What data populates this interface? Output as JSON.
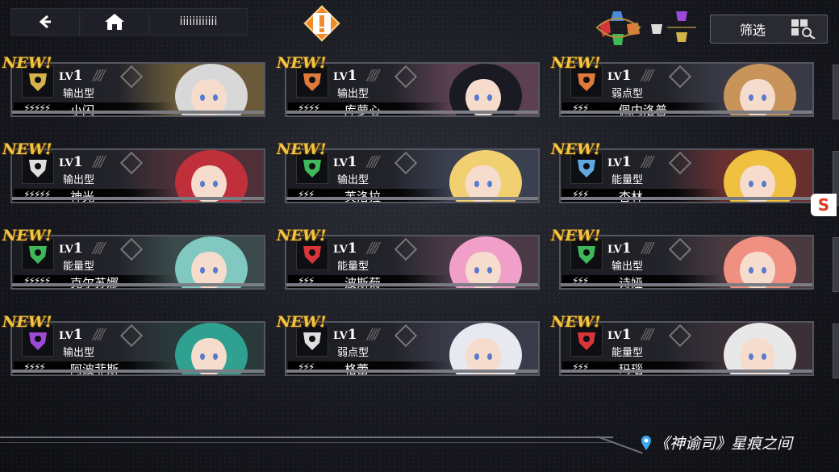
{
  "topbar": {
    "title": "iiiiiiiiiiii"
  },
  "filter": {
    "label": "筛选",
    "icons": [
      "red-wolf-icon",
      "blue-wing-icon",
      "orange-bull-icon",
      "green-tree-icon",
      "purple-crown-icon",
      "gold-star-icon",
      "white-shell-icon"
    ]
  },
  "new_label": "NEW!",
  "lv_prefix": "LV",
  "cards": [
    {
      "level": "1",
      "type": "输出型",
      "name": "小闪",
      "stars": "⚡⚡⚡⚡⚡",
      "badge_color": "#d4b44a",
      "icon": "trophy-icon"
    },
    {
      "level": "1",
      "type": "输出型",
      "name": "库萝心",
      "stars": "⚡⚡⚡⚡",
      "badge_color": "#e07a3a",
      "icon": "bull-icon"
    },
    {
      "level": "1",
      "type": "弱点型",
      "name": "佩内洛普",
      "stars": "⚡⚡⚡",
      "badge_color": "#e07a3a",
      "icon": "bull-icon"
    },
    {
      "level": "1",
      "type": "输出型",
      "name": "神光",
      "stars": "⚡⚡⚡⚡⚡",
      "badge_color": "#dedede",
      "icon": "wing-icon"
    },
    {
      "level": "1",
      "type": "输出型",
      "name": "芙洛拉",
      "stars": "⚡⚡⚡",
      "badge_color": "#3fb85a",
      "icon": "tree-icon"
    },
    {
      "level": "1",
      "type": "能量型",
      "name": "杏林",
      "stars": "⚡⚡⚡",
      "badge_color": "#5fa8e0",
      "icon": "lotus-icon"
    },
    {
      "level": "1",
      "type": "能量型",
      "name": "克尔苏娜",
      "stars": "⚡⚡⚡⚡⚡",
      "badge_color": "#3fb85a",
      "icon": "tree-icon"
    },
    {
      "level": "1",
      "type": "能量型",
      "name": "波斯菊",
      "stars": "⚡⚡⚡",
      "badge_color": "#d8353a",
      "icon": "wolf-icon"
    },
    {
      "level": "1",
      "type": "输出型",
      "name": "诗娅",
      "stars": "⚡⚡⚡",
      "badge_color": "#3fb85a",
      "icon": "tree-icon"
    },
    {
      "level": "1",
      "type": "输出型",
      "name": "阿波菲斯",
      "stars": "⚡⚡⚡⚡",
      "badge_color": "#9a4ad6",
      "icon": "crown-icon"
    },
    {
      "level": "1",
      "type": "弱点型",
      "name": "格蕾",
      "stars": "⚡⚡⚡",
      "badge_color": "#dedede",
      "icon": "wing-icon"
    },
    {
      "level": "1",
      "type": "能量型",
      "name": "玛瑙",
      "stars": "⚡⚡⚡",
      "badge_color": "#d8353a",
      "icon": "wolf-icon"
    }
  ],
  "portraits": [
    {
      "hair": "#d8d8d8",
      "bg": "#6a5a3a"
    },
    {
      "hair": "#1a1a22",
      "bg": "#5a4050"
    },
    {
      "hair": "#c8945a",
      "bg": "#3a3a46"
    },
    {
      "hair": "#c0303a",
      "bg": "#503038"
    },
    {
      "hair": "#f0d070",
      "bg": "#3a4050"
    },
    {
      "hair": "#f0c040",
      "bg": "#6a3030"
    },
    {
      "hair": "#80c8c0",
      "bg": "#3a4a4a"
    },
    {
      "hair": "#f0a0c8",
      "bg": "#4a3a48"
    },
    {
      "hair": "#f09080",
      "bg": "#4a3a40"
    },
    {
      "hair": "#30a090",
      "bg": "#2a3a3a"
    },
    {
      "hair": "#e8e8f0",
      "bg": "#3a3a48"
    },
    {
      "hair": "#e8e8e8",
      "bg": "#3a3038"
    }
  ],
  "location": "《神谕司》星痕之间",
  "sogou_label": "S"
}
